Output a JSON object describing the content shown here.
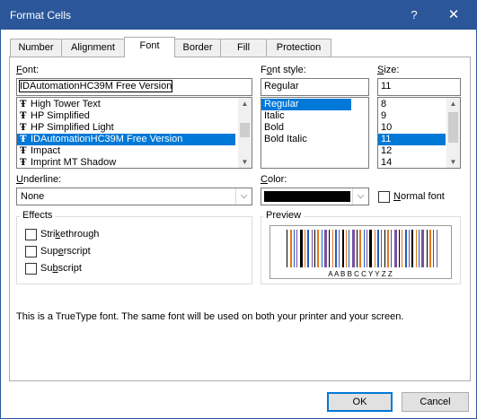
{
  "window": {
    "title": "Format Cells",
    "help_label": "?",
    "close_label": "✕"
  },
  "tabs": [
    {
      "label": "Number"
    },
    {
      "label": "Alignment"
    },
    {
      "label": "Font"
    },
    {
      "label": "Border"
    },
    {
      "label": "Fill"
    },
    {
      "label": "Protection"
    }
  ],
  "active_tab": "Font",
  "font": {
    "label_key": "F",
    "label_rest": "ont:",
    "value": "IDAutomationHC39M Free Version",
    "list": [
      {
        "name": "High Tower Text"
      },
      {
        "name": "HP Simplified"
      },
      {
        "name": "HP Simplified Light"
      },
      {
        "name": "IDAutomationHC39M Free Version",
        "selected": true
      },
      {
        "name": "Impact"
      },
      {
        "name": "Imprint MT Shadow"
      }
    ]
  },
  "font_style": {
    "label_pre": "F",
    "label_key": "o",
    "label_rest": "nt style:",
    "value": "Regular",
    "list": [
      {
        "name": "Regular",
        "selected": true
      },
      {
        "name": "Italic"
      },
      {
        "name": "Bold"
      },
      {
        "name": "Bold Italic"
      }
    ]
  },
  "size": {
    "label_key": "S",
    "label_rest": "ize:",
    "value": "11",
    "list": [
      {
        "name": "8"
      },
      {
        "name": "9"
      },
      {
        "name": "10"
      },
      {
        "name": "11",
        "selected": true
      },
      {
        "name": "12"
      },
      {
        "name": "14"
      }
    ]
  },
  "underline": {
    "label_key": "U",
    "label_rest": "nderline:",
    "value": "None"
  },
  "color": {
    "label_key": "C",
    "label_rest": "olor:",
    "value_hex": "#000000"
  },
  "normal_font": {
    "label_key": "N",
    "label_rest": "ormal font",
    "checked": false
  },
  "effects": {
    "title": "Effects",
    "items": [
      {
        "pre": "Stri",
        "key": "k",
        "rest": "ethrough",
        "checked": false
      },
      {
        "pre": "Sup",
        "key": "e",
        "rest": "rscript",
        "checked": false
      },
      {
        "pre": "Su",
        "key": "b",
        "rest": "script",
        "checked": false
      }
    ]
  },
  "preview": {
    "title": "Preview",
    "caption": "A A B B C C Y Y Z Z",
    "bar_colors": [
      "#000000",
      "#e07a1f",
      "#1f5fbf",
      "#7a4fa0"
    ]
  },
  "info_text": "This is a TrueType font.  The same font will be used on both your printer and your screen.",
  "buttons": {
    "ok": "OK",
    "cancel": "Cancel"
  }
}
